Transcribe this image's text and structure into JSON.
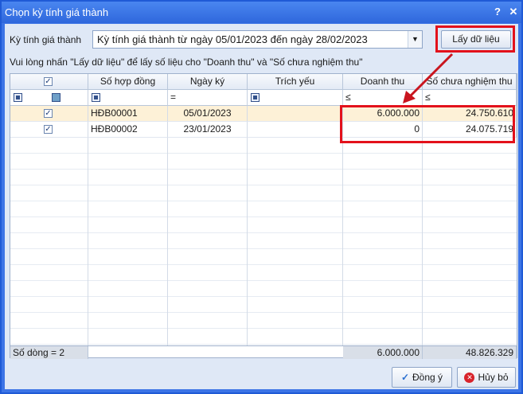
{
  "window": {
    "title": "Chọn kỳ tính giá thành",
    "help": "?",
    "close": "✕"
  },
  "period": {
    "label": "Kỳ tính giá thành",
    "value": "Kỳ tính giá thành từ ngày 05/01/2023 đến ngày 28/02/2023"
  },
  "fetch_button": "Lấy dữ liệu",
  "hint": "Vui lòng nhấn \"Lấy dữ liệu\" để lấy số liệu cho \"Doanh thu\" và \"Số chưa nghiệm thu\"",
  "grid": {
    "headers": [
      "",
      "Số hợp đồng",
      "Ngày ký",
      "Trích yếu",
      "Doanh thu",
      "Số chưa nghiệm thu"
    ],
    "filters": {
      "ngay_ky": "=",
      "doanh_thu": "≤",
      "so_chua": "≤"
    },
    "rows": [
      {
        "checked": true,
        "contract": "HĐB00001",
        "date": "05/01/2023",
        "summary": "",
        "revenue": "6.000.000",
        "unaccepted": "24.750.610"
      },
      {
        "checked": true,
        "contract": "HĐB00002",
        "date": "23/01/2023",
        "summary": "",
        "revenue": "0",
        "unaccepted": "24.075.719"
      }
    ],
    "footer": {
      "count": "Số dòng = 2",
      "revenue_total": "6.000.000",
      "unaccepted_total": "48.826.329"
    }
  },
  "ok_button": "Đồng ý",
  "cancel_button": "Hủy bỏ",
  "colors": {
    "title_bar": "#2f67dc",
    "highlight": "#e3111b",
    "selected_row": "#fdf1d7"
  }
}
